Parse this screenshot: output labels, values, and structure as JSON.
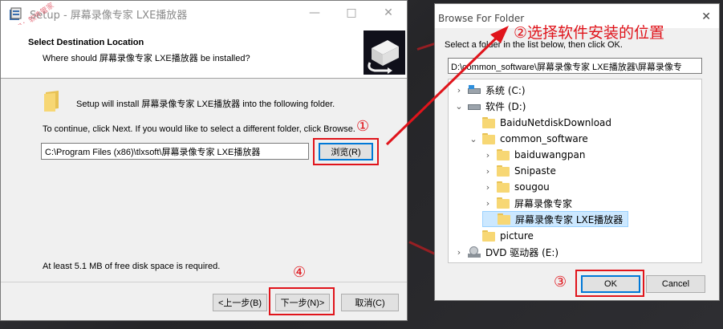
{
  "setup": {
    "title": "Setup - 屏幕录像专家 LXE播放器",
    "watermark": "公众号：软件管家",
    "header_title": "Select Destination Location",
    "header_subtitle": "Where should 屏幕录像专家 LXE播放器 be installed?",
    "install_text": "Setup will install 屏幕录像专家 LXE播放器 into the following folder.",
    "continue_text": "To continue, click Next. If you would like to select a different folder, click Browse.",
    "path_value": "C:\\Program Files (x86)\\tlxsoft\\屏幕录像专家 LXE播放器",
    "browse_label": "浏览(R)",
    "space_text": "At least 5.1 MB of free disk space is required.",
    "back_label": "<上一步(B)",
    "next_label": "下一步(N)>",
    "cancel_label": "取消(C)"
  },
  "browse": {
    "title": "Browse For Folder",
    "instruction": "Select a folder in the list below, then click OK.",
    "path_value": "D:\\common_software\\屏幕录像专家 LXE播放器\\屏幕录像专",
    "ok_label": "OK",
    "cancel_label": "Cancel",
    "tree": [
      {
        "label": "系统 (C:)",
        "icon": "drive-icon",
        "chevron": "›"
      },
      {
        "label": "软件 (D:)",
        "icon": "drive-icon",
        "chevron": "⌄"
      },
      {
        "label": "BaiduNetdiskDownload",
        "icon": "folder-icon",
        "chevron": ""
      },
      {
        "label": "common_software",
        "icon": "folder-icon",
        "chevron": "⌄"
      },
      {
        "label": "baiduwangpan",
        "icon": "folder-icon",
        "chevron": "›"
      },
      {
        "label": "Snipaste",
        "icon": "folder-icon",
        "chevron": "›"
      },
      {
        "label": "sougou",
        "icon": "folder-icon",
        "chevron": "›"
      },
      {
        "label": "屏幕录像专家",
        "icon": "folder-icon",
        "chevron": "›"
      },
      {
        "label": "屏幕录像专家 LXE播放器",
        "icon": "folder-icon",
        "chevron": ""
      },
      {
        "label": "picture",
        "icon": "folder-icon",
        "chevron": ""
      },
      {
        "label": "DVD 驱动器 (E:)",
        "icon": "dvd-icon",
        "chevron": "›"
      }
    ]
  },
  "annotations": {
    "step1": "①",
    "step2": "②选择软件安装的位置",
    "step3": "③",
    "step4": "④",
    "color": "#e0141b"
  }
}
